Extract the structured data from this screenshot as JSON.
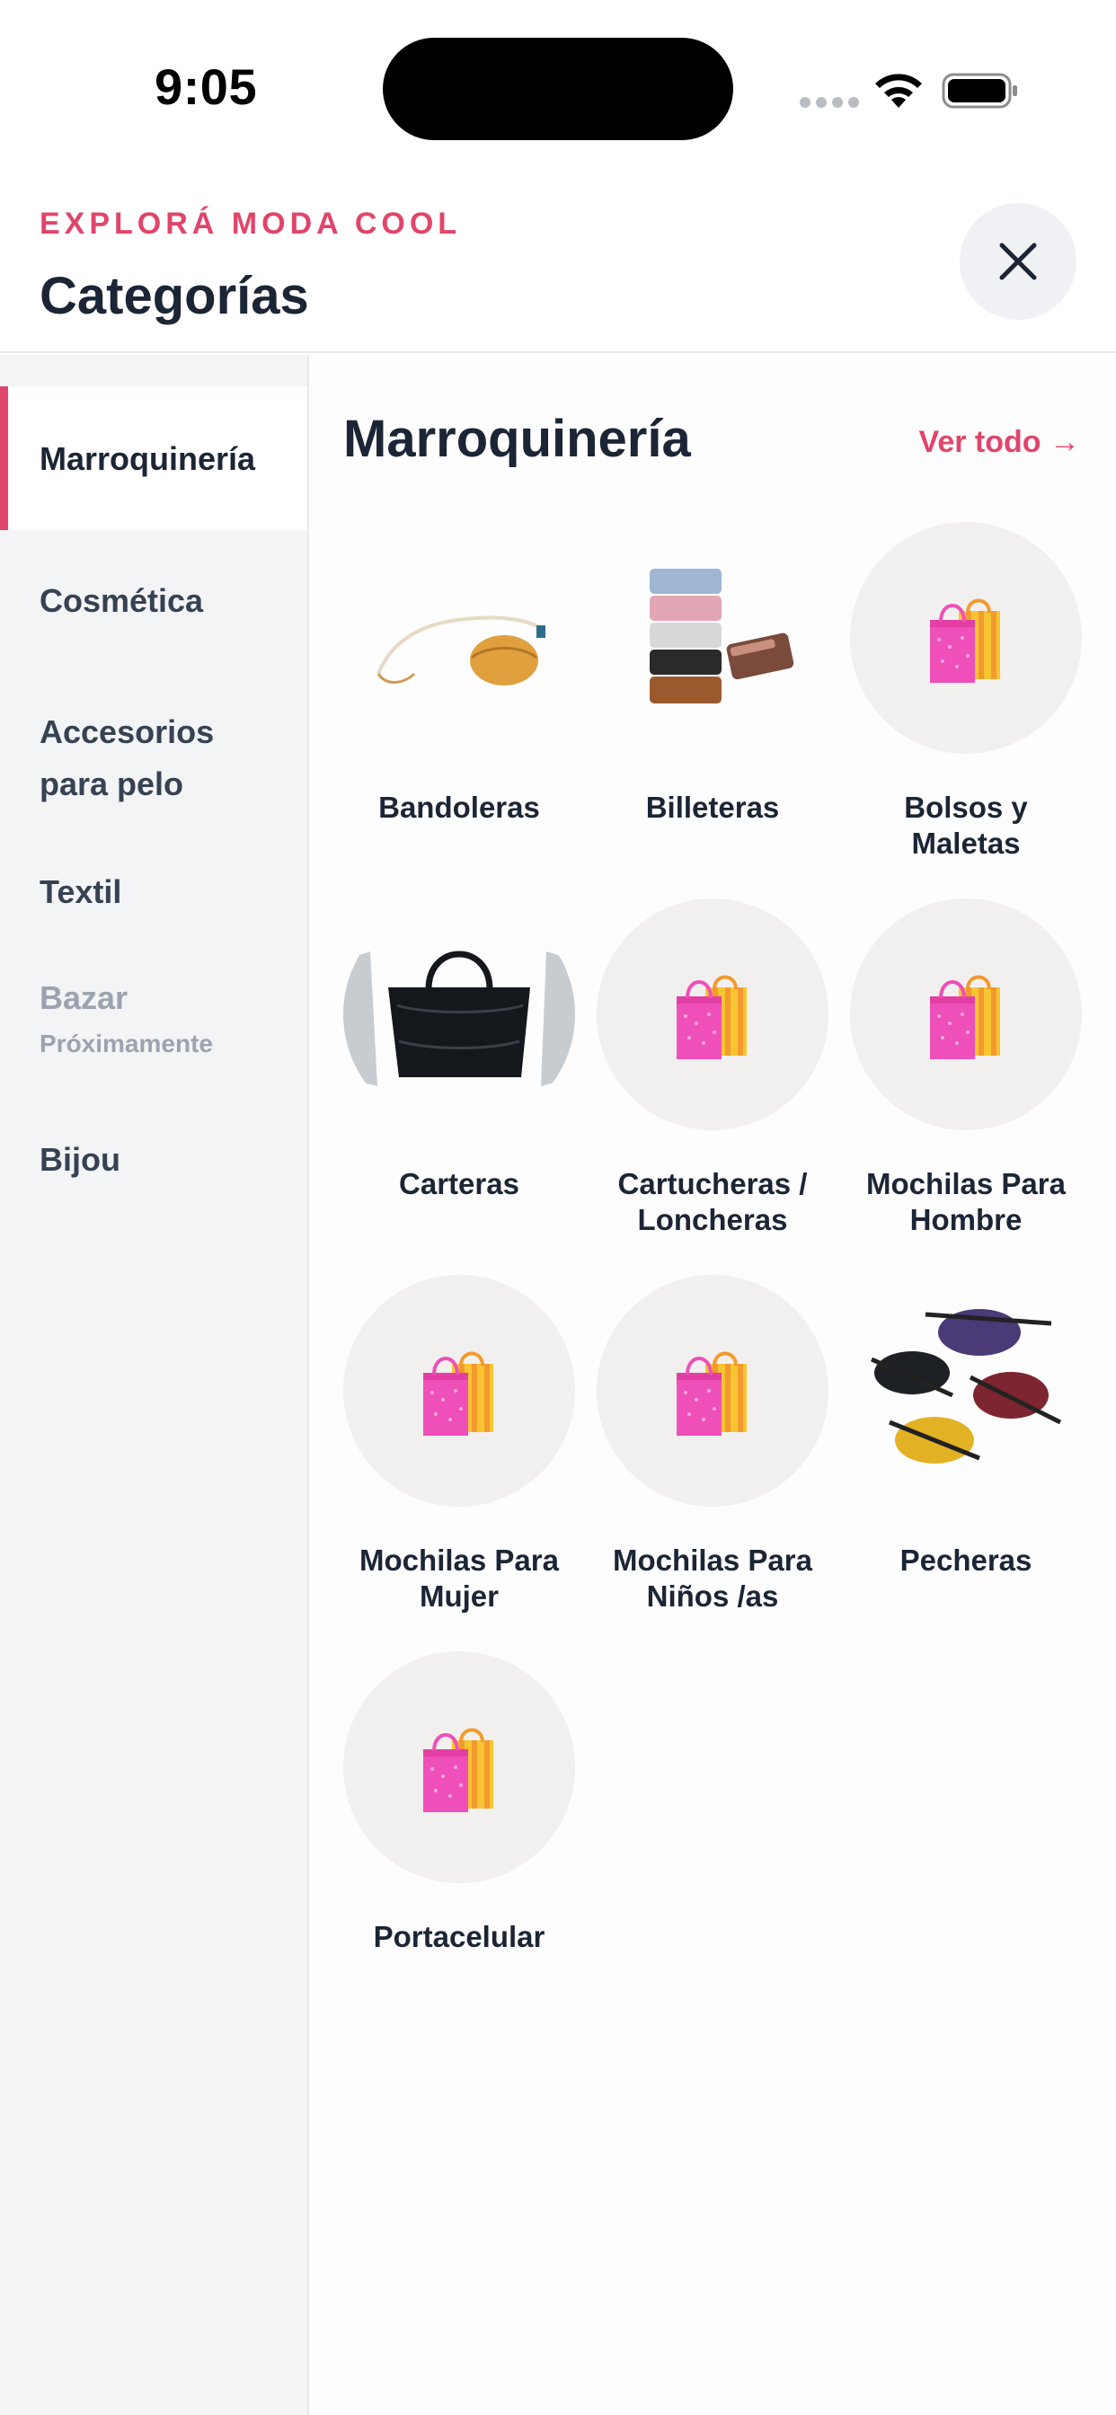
{
  "status_bar": {
    "time": "9:05"
  },
  "header": {
    "eyebrow": "EXPLORÁ MODA COOL",
    "title": "Categorías",
    "close_icon": "close-icon"
  },
  "sidebar": {
    "items": [
      {
        "label": "Marroquinería",
        "active": true
      },
      {
        "label": "Cosmética"
      },
      {
        "label": "Accesorios para pelo"
      },
      {
        "label": "Textil"
      },
      {
        "label": "Bazar",
        "sublabel": "Próximamente",
        "disabled": true
      },
      {
        "label": "Bijou"
      }
    ]
  },
  "main": {
    "title": "Marroquinería",
    "view_all": "Ver todo →",
    "categories": [
      {
        "label": "Bandoleras",
        "image": "crossbody-bag-photo"
      },
      {
        "label": "Billeteras",
        "image": "wallets-photo"
      },
      {
        "label": "Bolsos y Maletas",
        "image": "shopping-bags-icon"
      },
      {
        "label": "Carteras",
        "image": "handbag-photo"
      },
      {
        "label": "Cartucheras / Loncheras",
        "image": "shopping-bags-icon"
      },
      {
        "label": "Mochilas Para Hombre",
        "image": "shopping-bags-icon"
      },
      {
        "label": "Mochilas Para Mujer",
        "image": "shopping-bags-icon"
      },
      {
        "label": "Mochilas Para Niños /as",
        "image": "shopping-bags-icon"
      },
      {
        "label": "Pecheras",
        "image": "fanny-packs-photo"
      },
      {
        "label": "Portacelular",
        "image": "shopping-bags-icon"
      }
    ]
  },
  "colors": {
    "accent": "#e0456b",
    "text": "#1b2535",
    "muted": "#9ca3af",
    "sidebar_bg": "#f3f4f6"
  }
}
